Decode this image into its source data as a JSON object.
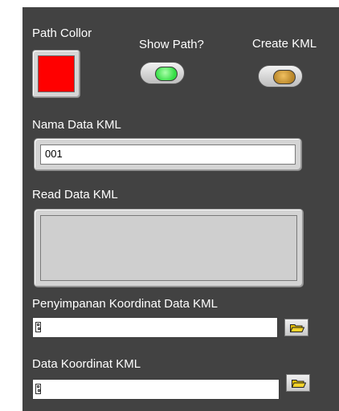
{
  "labels": {
    "path_color": "Path Collor",
    "show_path": "Show Path?",
    "create_kml": "Create KML",
    "nama_data_kml": "Nama Data KML",
    "read_data_kml": "Read Data KML",
    "penyimpanan": "Penyimpanan Koordinat Data KML",
    "data_koordinat": "Data Koordinat KML"
  },
  "values": {
    "nama_data_kml": "001",
    "read_data_kml": "",
    "penyimpanan_path": "",
    "data_koordinat_path": ""
  },
  "colors": {
    "panel_bg": "#424242",
    "path_color_swatch": "#ff0000",
    "show_path_led": "#33dd44",
    "create_kml_led": "#b8862a"
  },
  "icons": {
    "path": "path-icon",
    "browse": "folder-icon"
  }
}
